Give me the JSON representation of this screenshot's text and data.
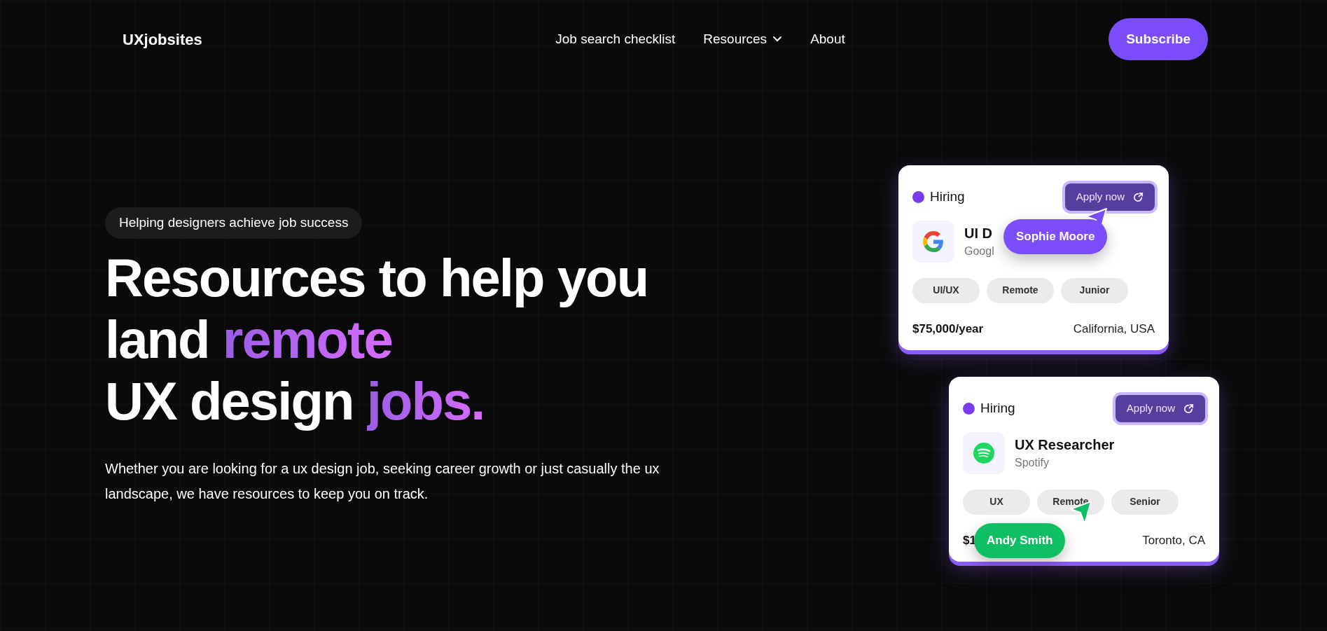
{
  "nav": {
    "logo": "UXjobsites",
    "links": [
      {
        "label": "Job search checklist",
        "dropdown": false
      },
      {
        "label": "Resources",
        "dropdown": true
      },
      {
        "label": "About",
        "dropdown": false
      }
    ],
    "subscribe": "Subscribe"
  },
  "hero": {
    "badge": "Helping designers achieve job success",
    "heading": [
      [
        {
          "text": "Resources to help you",
          "accent": false
        }
      ],
      [
        {
          "text": "land ",
          "accent": false
        },
        {
          "text": "remote",
          "accent": true
        }
      ],
      [
        {
          "text": "UX design ",
          "accent": false
        },
        {
          "text": "jobs.",
          "accent": true
        }
      ]
    ],
    "paragraph": "Whether you are looking for a ux design job, seeking career growth or just casually the ux landscape, we have resources to keep you on track."
  },
  "cards": [
    {
      "status": "Hiring",
      "apply": "Apply now",
      "logo": {
        "kind": "google"
      },
      "title": "UI D",
      "company": "Googl",
      "tags": [
        "UI/UX",
        "Remote",
        "Junior"
      ],
      "salary": "$75,000/year",
      "location": "California, USA",
      "cursor": {
        "name": "Sophie Moore",
        "color": "#7c4dff"
      }
    },
    {
      "status": "Hiring",
      "apply": "Apply now",
      "logo": {
        "kind": "spotify"
      },
      "title": "UX Researcher",
      "company": "Spotify",
      "tags": [
        "UX",
        "Remote",
        "Senior"
      ],
      "salary": "$1",
      "location": "Toronto, CA",
      "cursor": {
        "name": "Andy Smith",
        "color": "#0fbf63"
      }
    }
  ]
}
